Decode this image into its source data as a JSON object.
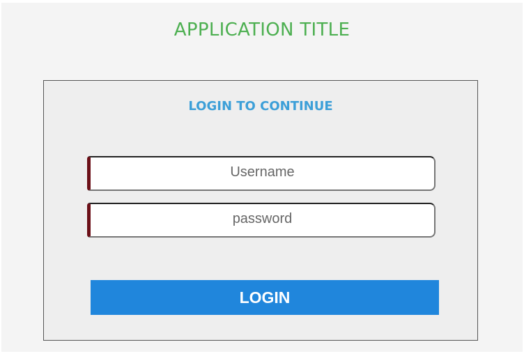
{
  "header": {
    "title": "APPLICATION TITLE"
  },
  "login": {
    "heading": "LOGIN TO CONTINUE",
    "username_placeholder": "Username",
    "password_placeholder": "password",
    "submit_label": "LOGIN"
  },
  "colors": {
    "title": "#4caf50",
    "heading": "#3c9fd8",
    "button": "#2086dc",
    "field_accent": "#6b0f17"
  }
}
